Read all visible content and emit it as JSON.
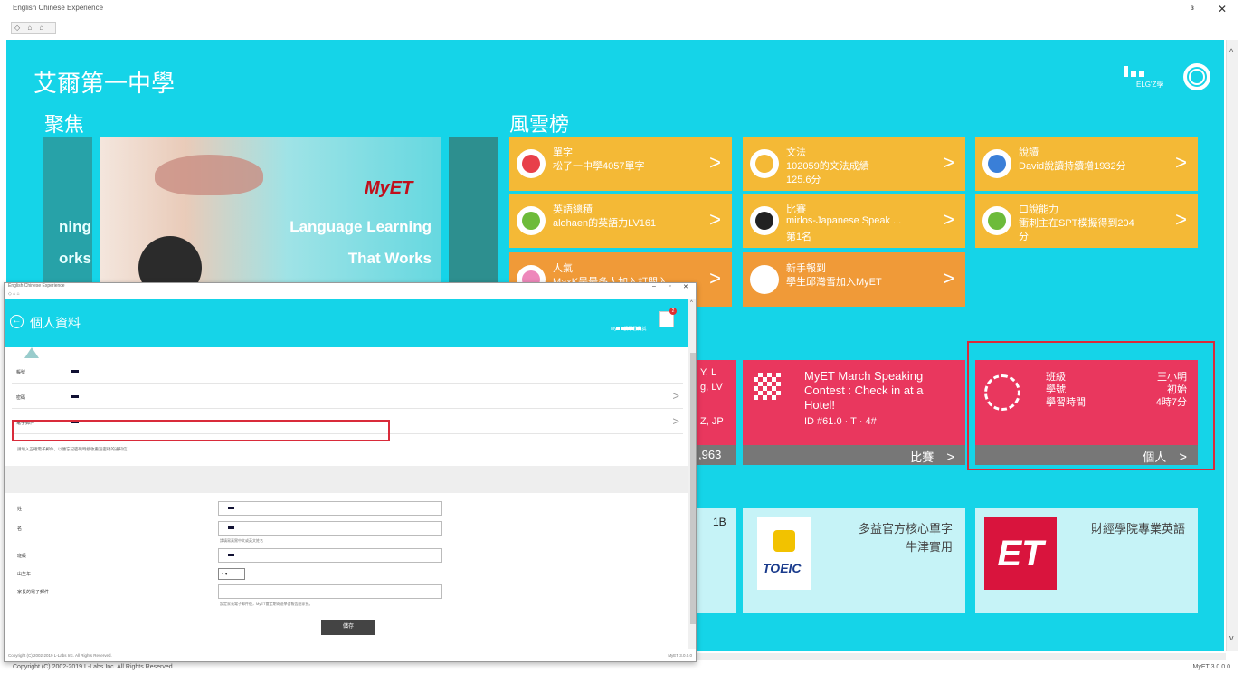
{
  "window": {
    "title": "English Chinese Experience",
    "nav": "◇ ⌂ ⌂",
    "minimize": "ᵌ",
    "close": "✕"
  },
  "header": {
    "school": "艾爾第一中學",
    "username": "ELG'Z學"
  },
  "sections": {
    "focus": "聚焦",
    "leaderboard": "風雲榜"
  },
  "hero": {
    "logo": "MyET",
    "line1": "Language Learning",
    "line2": "That Works",
    "side_left_1": "ning",
    "side_left_2": "orks"
  },
  "tiles": [
    {
      "title": "單字",
      "line2": "松了一中學4057單字",
      "line3": "",
      "icon_color": "#e8404a",
      "variant": "a"
    },
    {
      "title": "文法",
      "line2": "102059的文法成績",
      "line3": "125.6分",
      "icon_color": "#f4b936",
      "variant": "a"
    },
    {
      "title": "說讀",
      "line2": "David說讀持續增1932分",
      "line3": "",
      "icon_color": "#3a7fd8",
      "variant": "a"
    },
    {
      "title": "英語總積",
      "line2": "alohaen的英語力LV161",
      "line3": "",
      "icon_color": "#6dbb3a",
      "variant": "a"
    },
    {
      "title": "比賽",
      "line2": "mirlos-Japanese Speak ...",
      "line3": "第1名",
      "icon_color": "#222",
      "variant": "a"
    },
    {
      "title": "口說能力",
      "line2": "衝刺主在SPT模擬得到204",
      "line3": "分",
      "icon_color": "#6dbb3a",
      "variant": "a"
    },
    {
      "title": "人氣",
      "line2": "MaxK是最多人加入訂閱入",
      "line3": "",
      "icon_color": "#ee88bb",
      "variant": "b"
    },
    {
      "title": "新手報到",
      "line2": "學生邱灣雪加入MyET",
      "line3": "",
      "icon_color": "#fff",
      "variant": "b"
    }
  ],
  "contest": {
    "text": "MyET March Speaking Contest : Check in at a Hotel!",
    "sub": "ID #61.0 · T · 4#",
    "footer": "比賽"
  },
  "contest_partial": {
    "l1": "Y, L",
    "l2": "g, LV",
    "l3": "Z, JP",
    "l4": ",963"
  },
  "personal": {
    "label1": "班級",
    "value1": "王小明",
    "label2": "學號",
    "value2": "初始",
    "label3": "學習時間",
    "value3": "4時7分",
    "footer": "個人"
  },
  "courses": [
    {
      "title": "多益官方核心單字",
      "sub": "牛津實用",
      "badge": "TOEIC"
    },
    {
      "title": "財經學院專業英語",
      "sub": "",
      "badge": "ET"
    }
  ],
  "course_partial": "1B",
  "overlay": {
    "title": "English Chinese Experience",
    "nav": "◇ ⌂ ⌂",
    "header_title": "個人資料",
    "user": "MyET 讀學習測試",
    "badge": "2",
    "rows": [
      {
        "label": "帳號",
        "chev": false
      },
      {
        "label": "密碼",
        "chev": true
      },
      {
        "label": "電子郵件",
        "chev": true
      }
    ],
    "note": "請填入正確電子郵件，以便忘記密碼時接收重設密碼的通知信。",
    "fields": [
      {
        "label": "姓",
        "hint": ""
      },
      {
        "label": "名",
        "hint": "請填寫真實中文或英文姓名"
      },
      {
        "label": "班級",
        "hint": ""
      },
      {
        "label": "出生年",
        "hint": ""
      },
      {
        "label": "家長的電子郵件",
        "hint": "設定家長電子郵件後，MyET會定期寄送學習報告給家長。"
      }
    ],
    "select_value": "- ▾",
    "save": "儲存",
    "footer_left": "Copyright (C) 2002-2019 L-Labs Inc. All Rights Reserved.",
    "footer_right": "MyET 3.0.0.0"
  },
  "status": {
    "left": "Copyright (C) 2002-2019 L-Labs Inc. All Rights Reserved.",
    "right": "MyET 3.0.0.0"
  }
}
